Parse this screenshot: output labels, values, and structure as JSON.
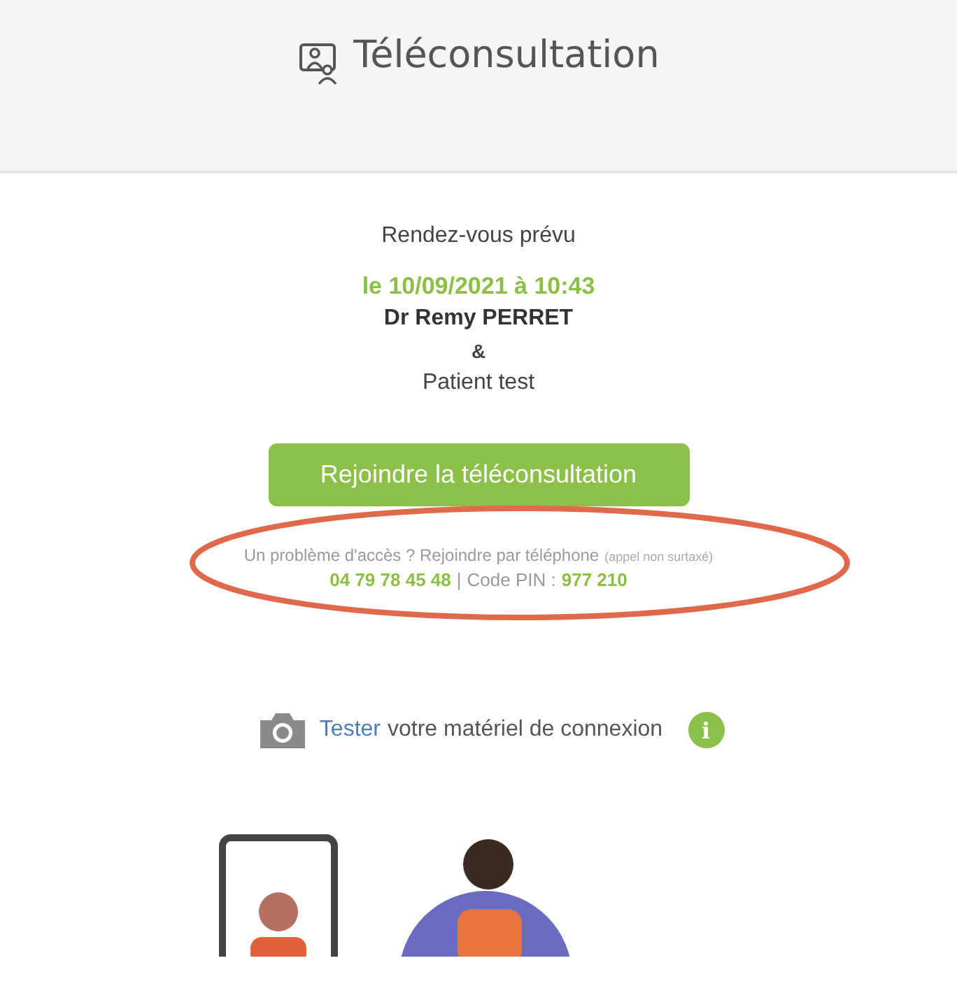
{
  "header": {
    "title": "Téléconsultation"
  },
  "appointment": {
    "label": "Rendez-vous prévu",
    "date": "le 10/09/2021 à 10:43",
    "doctor": "Dr Remy PERRET",
    "separator": "&",
    "patient": "Patient test"
  },
  "join_button": "Rejoindre la téléconsultation",
  "phone_help": {
    "question": "Un problème d'accès ? Rejoindre par téléphone",
    "note": "(appel non surtaxé)",
    "phone": "04 79 78 45 48",
    "divider": "|",
    "pin_label": "Code PIN :",
    "pin": "977 210"
  },
  "equipment_test": {
    "link": "Tester",
    "text": "votre matériel de connexion",
    "info": "i"
  }
}
